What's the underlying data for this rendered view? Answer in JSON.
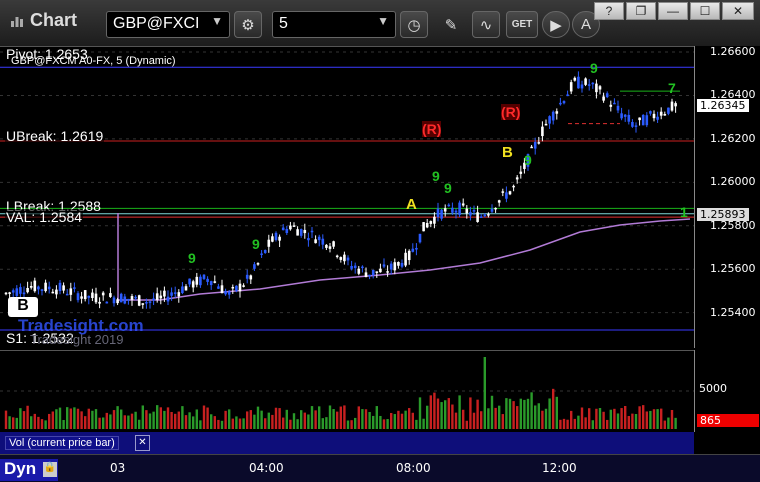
{
  "window": {
    "title": "Chart"
  },
  "toolbar": {
    "symbol": "GBP@FXCI",
    "interval": "5",
    "buttons": [
      "settings-icon",
      "clock-icon",
      "pencil-icon",
      "indicator-icon",
      "get-icon",
      "play-icon",
      "alert-icon"
    ],
    "get_label": "GET",
    "alert_label": "A"
  },
  "window_controls": {
    "help": "?",
    "restore": "❐",
    "minimize": "—",
    "maximize": "☐",
    "close": "✕"
  },
  "chart": {
    "subtitle": "GBP@FXCM A0-FX, 5 (Dynamic)",
    "watermark_line1": "Tradesight.com",
    "watermark_line2": "Tradesight 2019",
    "badge": "B",
    "levels": {
      "pivot": "Pivot: 1.2653",
      "ubreak": "UBreak: 1.2619",
      "lbreak": "LBreak: 1.2588",
      "val": "VAL: 1.2584",
      "s1": "S1: 1.2532"
    },
    "price_ticks": [
      "1.26600",
      "1.26400",
      "1.26200",
      "1.26000",
      "1.25800",
      "1.25600",
      "1.25400"
    ],
    "last_price": "1.26345",
    "vwap_price": "1.25893",
    "markers": {
      "a": "A",
      "b": "B",
      "r1": "(R)",
      "r2": "(R)"
    },
    "seq_labels": [
      "9",
      "9",
      "9",
      "9",
      "9",
      "9",
      "7",
      "1"
    ],
    "colors": {
      "up": "#ffffff",
      "down": "#2b5bff",
      "vwap": "#b27bd6",
      "pivot": "#3a3aff",
      "ubreak": "#cc1f1f",
      "lbreak": "#19b319",
      "val": "#e03030",
      "s1": "#3a3aff"
    }
  },
  "chart_data": {
    "type": "candlestick",
    "ylim": [
      1.2532,
      1.266
    ],
    "x_ticks": [
      "03",
      "04:00",
      "08:00",
      "12:00"
    ]
  },
  "volume": {
    "label": "Vol (current price bar)",
    "ticks": [
      "5000"
    ],
    "last_volume": "865"
  },
  "footer": {
    "dyn_label": "Dyn"
  }
}
